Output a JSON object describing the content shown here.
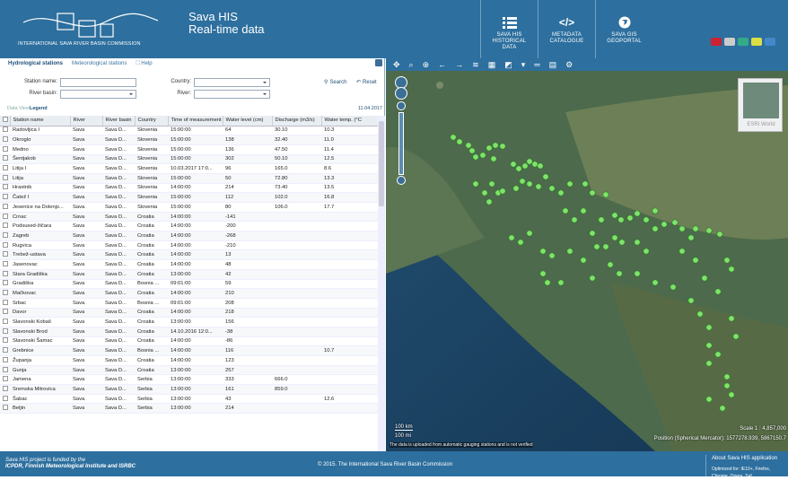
{
  "header": {
    "org": "INTERNATIONAL SAVA RIVER BASIN COMMISSION",
    "title_line1": "Sava HIS",
    "title_line2": "Real-time data",
    "nav": [
      {
        "l1": "SAVA HIS",
        "l2": "HISTORICAL",
        "l3": "DATA",
        "icon": "list-icon"
      },
      {
        "l1": "METADATA",
        "l2": "CATALOGUE",
        "l3": "",
        "icon": "code-icon"
      },
      {
        "l1": "SAVA GIS",
        "l2": "GEOPORTAL",
        "l3": "",
        "icon": "globe-icon"
      }
    ],
    "flags": [
      "#c23",
      "#ccc",
      "#3a8",
      "#dd4",
      "#48c"
    ]
  },
  "tabs": {
    "hydro": "Hydrological stations",
    "meteo": "Meteorological stations",
    "help": "Help"
  },
  "filters": {
    "station_name": "Station name:",
    "river_basin": "River basin:",
    "country": "Country:",
    "river": "River:",
    "search": "Search",
    "reset": "Reset"
  },
  "viewbar": {
    "data_view": "Data View",
    "legend": "Legend",
    "date": "11.04.2017"
  },
  "table": {
    "columns": [
      "Station name",
      "River",
      "River basin",
      "Country",
      "Time of measurement",
      "Water level (cm)",
      "Discharge (m3/s)",
      "Water temp. (°C"
    ],
    "rows": [
      [
        "Radovljica I",
        "Sava",
        "Sava D...",
        "Slovenia",
        "15:00:00",
        "64",
        "30.10",
        "10.3"
      ],
      [
        "Okroglo",
        "Sava",
        "Sava D...",
        "Slovenia",
        "15:00:00",
        "138",
        "32.40",
        "11.0"
      ],
      [
        "Medno",
        "Sava",
        "Sava D...",
        "Slovenia",
        "15:00:00",
        "136",
        "47.50",
        "11.4"
      ],
      [
        "Šentjakob",
        "Sava",
        "Sava D...",
        "Slovenia",
        "15:00:00",
        "302",
        "50.10",
        "12.5"
      ],
      [
        "Litija I",
        "Sava",
        "Sava D...",
        "Slovenia",
        "10.03.2017 17:0...",
        "96",
        "165.0",
        "8.6"
      ],
      [
        "Litija",
        "Sava",
        "Sava D...",
        "Slovenia",
        "15:00:00",
        "50",
        "72.80",
        "13.3"
      ],
      [
        "Hrastnik",
        "Sava",
        "Sava D...",
        "Slovenia",
        "14:00:00",
        "214",
        "73.40",
        "13.5"
      ],
      [
        "Čatež I",
        "Sava",
        "Sava D...",
        "Slovenia",
        "15:00:00",
        "112",
        "102.0",
        "16.8"
      ],
      [
        "Jesenice na Dolenjs...",
        "Sava",
        "Sava D...",
        "Slovenia",
        "15:00:00",
        "80",
        "106.0",
        "17.7"
      ],
      [
        "Crnac",
        "Sava",
        "Sava D...",
        "Croatia",
        "14:00:00",
        "-141",
        "",
        ""
      ],
      [
        "Podsused-žičara",
        "Sava",
        "Sava D...",
        "Croatia",
        "14:00:00",
        "-200",
        "",
        ""
      ],
      [
        "Zagreb",
        "Sava",
        "Sava D...",
        "Croatia",
        "14:00:00",
        "-268",
        "",
        ""
      ],
      [
        "Rugvica",
        "Sava",
        "Sava D...",
        "Croatia",
        "14:00:00",
        "-210",
        "",
        ""
      ],
      [
        "Trebež-ustava",
        "Sava",
        "Sava D...",
        "Croatia",
        "14:00:00",
        "13",
        "",
        ""
      ],
      [
        "Jasenovac",
        "Sava",
        "Sava D...",
        "Croatia",
        "14:00:00",
        "48",
        "",
        ""
      ],
      [
        "Stara Gradiška",
        "Sava",
        "Sava D...",
        "Croatia",
        "13:00:00",
        "42",
        "",
        ""
      ],
      [
        "Gradiška",
        "Sava",
        "Sava D...",
        "Bosnia ...",
        "09:01:00",
        "59",
        "",
        ""
      ],
      [
        "Mačkovac",
        "Sava",
        "Sava D...",
        "Croatia",
        "14:00:00",
        "210",
        "",
        ""
      ],
      [
        "Srbac",
        "Sava",
        "Sava D...",
        "Bosnia ...",
        "09:01:00",
        "208",
        "",
        ""
      ],
      [
        "Davor",
        "Sava",
        "Sava D...",
        "Croatia",
        "14:00:00",
        "218",
        "",
        ""
      ],
      [
        "Slavonski Kobaš",
        "Sava",
        "Sava D...",
        "Croatia",
        "13:00:00",
        "156",
        "",
        ""
      ],
      [
        "Slavonski Brod",
        "Sava",
        "Sava D...",
        "Croatia",
        "14.10.2016 12:0...",
        "-38",
        "",
        ""
      ],
      [
        "Slavonski Šamac",
        "Sava",
        "Sava D...",
        "Croatia",
        "14:00:00",
        "-86",
        "",
        ""
      ],
      [
        "Grebnice",
        "Sava",
        "Sava D...",
        "Bosnia ...",
        "14:00:00",
        "116",
        "",
        "10.7"
      ],
      [
        "Županja",
        "Sava",
        "Sava D...",
        "Croatia",
        "14:00:00",
        "123",
        "",
        ""
      ],
      [
        "Gunja",
        "Sava",
        "Sava D...",
        "Croatia",
        "13:00:00",
        "257",
        "",
        ""
      ],
      [
        "Jamena",
        "Sava",
        "Sava D...",
        "Serbia",
        "13:00:00",
        "333",
        "666.0",
        ""
      ],
      [
        "Sremska Mitrovica",
        "Sava",
        "Sava D...",
        "Serbia",
        "13:00:00",
        "161",
        "859.0",
        ""
      ],
      [
        "Šabac",
        "Sava",
        "Sava D...",
        "Serbia",
        "13:00:00",
        "43",
        "",
        "12.6"
      ],
      [
        "Beljin",
        "Sava",
        "Sava D...",
        "Serbia",
        "13:00:00",
        "214",
        "",
        ""
      ]
    ]
  },
  "map": {
    "basemap_label": "ESRI World",
    "scale_km": "100 km",
    "scale_mi": "100 mi",
    "notice": "The data is uploaded from automatic gauging stations and is not verified",
    "scale_text": "Scale 1 : 4,857,000",
    "position_text": "Position (Spherical Mercator): 1577278.939, 5867150.7"
  },
  "footer": {
    "funded1": "Sava HIS project is funded by the",
    "funded2": "ICPDR, Finnish Meteorological Institute and ISRBC",
    "copyright": "© 2015. The International Sava River Basin Commission",
    "about": "About Sava HIS application",
    "optimized": "Optimized for: IE10+, Firefox, Chrome, Opera, Saf"
  }
}
